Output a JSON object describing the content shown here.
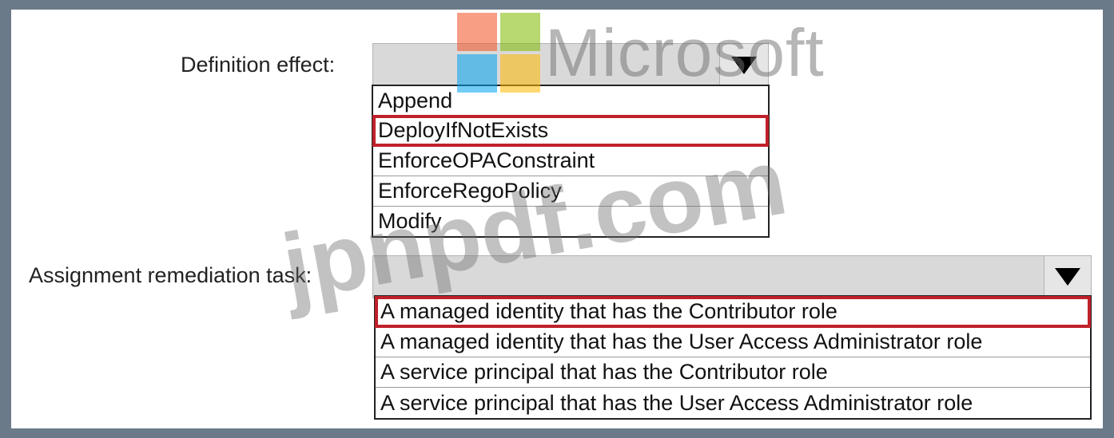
{
  "definition_effect": {
    "label": "Definition effect:",
    "selected_value": "",
    "options": [
      {
        "text": "Append",
        "selected": false
      },
      {
        "text": "DeployIfNotExists",
        "selected": true
      },
      {
        "text": "EnforceOPAConstraint",
        "selected": false
      },
      {
        "text": "EnforceRegoPolicy",
        "selected": false
      },
      {
        "text": "Modify",
        "selected": false
      }
    ]
  },
  "assignment_remediation_task": {
    "label": "Assignment remediation task:",
    "selected_value": "",
    "options": [
      {
        "text": "A managed identity that has the Contributor role",
        "selected": true
      },
      {
        "text": "A managed identity that has the User Access Administrator role",
        "selected": false
      },
      {
        "text": "A service principal that has the Contributor role",
        "selected": false
      },
      {
        "text": "A service principal that has the User Access Administrator role",
        "selected": false
      }
    ]
  },
  "watermarks": {
    "brand": "Microsoft",
    "site": "jpnpdf.com",
    "logo_colors": [
      "#f25022",
      "#7fba00",
      "#00a4ef",
      "#ffb900"
    ]
  },
  "colors": {
    "highlight": "#c0202a",
    "dropdown_bg": "#d9d9d9",
    "frame": "#6b7a88"
  }
}
